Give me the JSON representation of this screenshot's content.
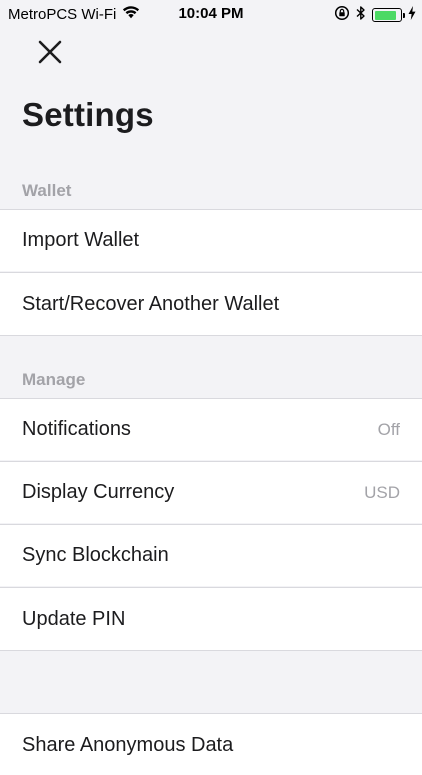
{
  "status_bar": {
    "carrier": "MetroPCS Wi-Fi",
    "time": "10:04 PM",
    "battery_level": 0.85,
    "battery_color": "#4cd964"
  },
  "header": {
    "close_icon": "close-icon",
    "title": "Settings"
  },
  "sections": {
    "wallet": {
      "label": "Wallet",
      "items": [
        {
          "label": "Import Wallet"
        },
        {
          "label": "Start/Recover Another Wallet"
        }
      ]
    },
    "manage": {
      "label": "Manage",
      "items": [
        {
          "label": "Notifications",
          "value": "Off"
        },
        {
          "label": "Display Currency",
          "value": "USD"
        },
        {
          "label": "Sync Blockchain"
        },
        {
          "label": "Update PIN"
        }
      ]
    },
    "other": {
      "items": [
        {
          "label": "Share Anonymous Data"
        }
      ]
    }
  },
  "colors": {
    "background": "#f3f3f6",
    "section_label": "#a3a3a8",
    "separator": "#d9d9de"
  }
}
